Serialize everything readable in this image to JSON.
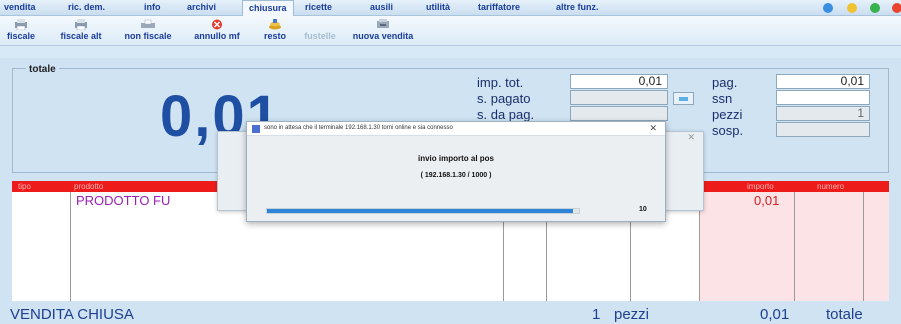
{
  "menu": {
    "items": [
      "vendita",
      "ric. dem.",
      "info",
      "archivi",
      "chiusura",
      "ricette",
      "ausili",
      "utilità",
      "tariffatore",
      "altre funz."
    ],
    "active": "chiusura"
  },
  "toolbar": {
    "buttons": [
      {
        "label": "fiscale",
        "icon": "printer-icon"
      },
      {
        "label": "fiscale alt",
        "icon": "printer-icon"
      },
      {
        "label": "non fiscale",
        "icon": "receipt-printer-icon"
      },
      {
        "label": "annullo mf",
        "icon": "cancel-icon"
      },
      {
        "label": "resto",
        "icon": "coins-icon"
      },
      {
        "label": "fustelle",
        "icon": "fustelle-icon",
        "disabled": true
      },
      {
        "label": "nuova vendita",
        "icon": "new-sale-icon"
      }
    ]
  },
  "totals": {
    "legend": "totale",
    "big_total": "0,01",
    "fields_left": [
      {
        "label": "imp. tot.",
        "value": "0,01"
      },
      {
        "label": "s. pagato",
        "value": ""
      },
      {
        "label": "s. da pag.",
        "value": ""
      }
    ],
    "fields_right": [
      {
        "label": "pag.",
        "value": "0,01"
      },
      {
        "label": "ssn",
        "value": ""
      },
      {
        "label": "pezzi",
        "value": "1"
      },
      {
        "label": "sosp.",
        "value": ""
      }
    ]
  },
  "table": {
    "headers": [
      "tipo",
      "prodotto",
      "importo",
      "numero"
    ],
    "rows": [
      {
        "prodotto": "PRODOTTO FU",
        "importo": "0,01"
      }
    ]
  },
  "status": {
    "state": "VENDITA CHIUSA",
    "pieces_count": "1",
    "pieces_label": "pezzi",
    "total_value": "0,01",
    "total_label": "totale"
  },
  "dialog": {
    "title": "sono in attesa che il terminale 192.168.1.30 torni online e sia connesso",
    "close": "✕",
    "message": "invio importo al pos",
    "detail": "( 192.168.1.30 / 1000 )",
    "progress_fraction": 0.98,
    "progress_number": "10"
  },
  "colors": {
    "accent_blue": "#1f4fa3",
    "header_red": "#ee1b1b",
    "product_purple": "#9b1fb3",
    "importo_red": "#d21f1f"
  }
}
